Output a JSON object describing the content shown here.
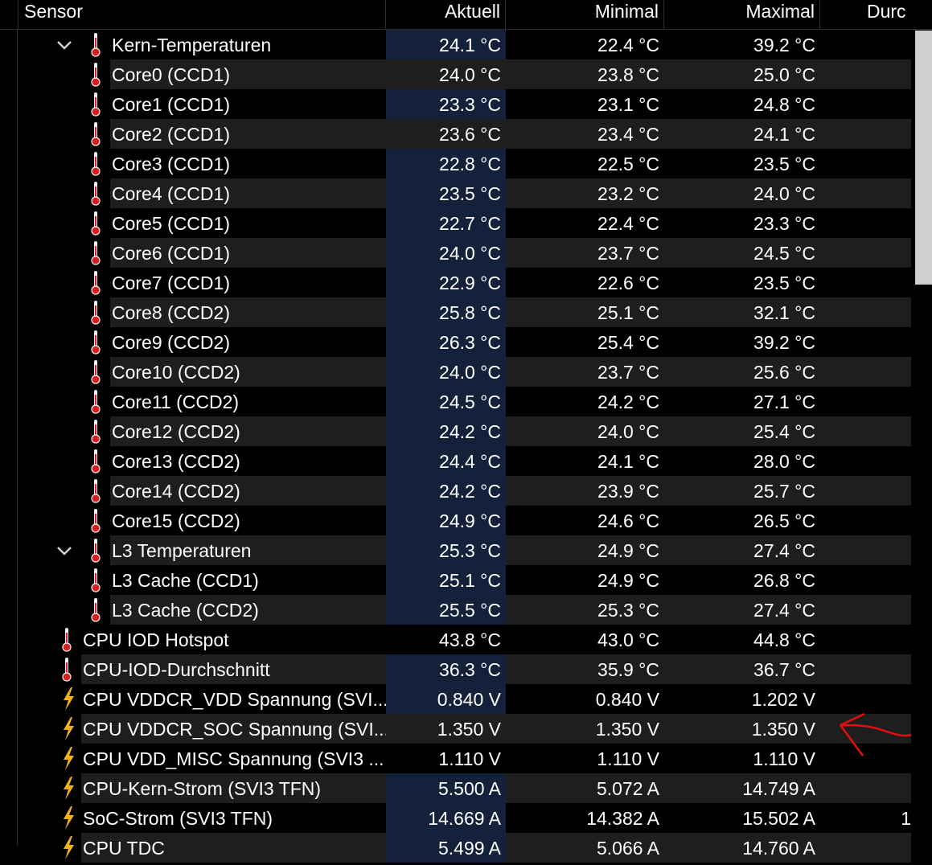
{
  "columns": {
    "sensor": "Sensor",
    "current": "Aktuell",
    "min": "Minimal",
    "max": "Maximal",
    "avg": "Durc"
  },
  "rows": [
    {
      "label": "Kern-Temperaturen",
      "cur": "24.1 °C",
      "min": "22.4 °C",
      "max": "39.2 °C",
      "icon": "thermometer-icon",
      "group": true,
      "level": 1
    },
    {
      "label": "Core0 (CCD1)",
      "cur": "24.0 °C",
      "min": "23.8 °C",
      "max": "25.0 °C",
      "icon": "thermometer-icon",
      "level": 1
    },
    {
      "label": "Core1 (CCD1)",
      "cur": "23.3 °C",
      "min": "23.1 °C",
      "max": "24.8 °C",
      "icon": "thermometer-icon",
      "level": 1
    },
    {
      "label": "Core2 (CCD1)",
      "cur": "23.6 °C",
      "min": "23.4 °C",
      "max": "24.1 °C",
      "icon": "thermometer-icon",
      "level": 1
    },
    {
      "label": "Core3 (CCD1)",
      "cur": "22.8 °C",
      "min": "22.5 °C",
      "max": "23.5 °C",
      "icon": "thermometer-icon",
      "level": 1
    },
    {
      "label": "Core4 (CCD1)",
      "cur": "23.5 °C",
      "min": "23.2 °C",
      "max": "24.0 °C",
      "icon": "thermometer-icon",
      "level": 1
    },
    {
      "label": "Core5 (CCD1)",
      "cur": "22.7 °C",
      "min": "22.4 °C",
      "max": "23.3 °C",
      "icon": "thermometer-icon",
      "level": 1
    },
    {
      "label": "Core6 (CCD1)",
      "cur": "24.0 °C",
      "min": "23.7 °C",
      "max": "24.5 °C",
      "icon": "thermometer-icon",
      "level": 1
    },
    {
      "label": "Core7 (CCD1)",
      "cur": "22.9 °C",
      "min": "22.6 °C",
      "max": "23.5 °C",
      "icon": "thermometer-icon",
      "level": 1
    },
    {
      "label": "Core8 (CCD2)",
      "cur": "25.8 °C",
      "min": "25.1 °C",
      "max": "32.1 °C",
      "icon": "thermometer-icon",
      "level": 1
    },
    {
      "label": "Core9 (CCD2)",
      "cur": "26.3 °C",
      "min": "25.4 °C",
      "max": "39.2 °C",
      "icon": "thermometer-icon",
      "level": 1
    },
    {
      "label": "Core10 (CCD2)",
      "cur": "24.0 °C",
      "min": "23.7 °C",
      "max": "25.6 °C",
      "icon": "thermometer-icon",
      "level": 1
    },
    {
      "label": "Core11 (CCD2)",
      "cur": "24.5 °C",
      "min": "24.2 °C",
      "max": "27.1 °C",
      "icon": "thermometer-icon",
      "level": 1
    },
    {
      "label": "Core12 (CCD2)",
      "cur": "24.2 °C",
      "min": "24.0 °C",
      "max": "25.4 °C",
      "icon": "thermometer-icon",
      "level": 1
    },
    {
      "label": "Core13 (CCD2)",
      "cur": "24.4 °C",
      "min": "24.1 °C",
      "max": "28.0 °C",
      "icon": "thermometer-icon",
      "level": 1
    },
    {
      "label": "Core14 (CCD2)",
      "cur": "24.2 °C",
      "min": "23.9 °C",
      "max": "25.7 °C",
      "icon": "thermometer-icon",
      "level": 1
    },
    {
      "label": "Core15 (CCD2)",
      "cur": "24.9 °C",
      "min": "24.6 °C",
      "max": "26.5 °C",
      "icon": "thermometer-icon",
      "level": 1
    },
    {
      "label": "L3 Temperaturen",
      "cur": "25.3 °C",
      "min": "24.9 °C",
      "max": "27.4 °C",
      "icon": "thermometer-icon",
      "group": true,
      "level": 1
    },
    {
      "label": "L3 Cache (CCD1)",
      "cur": "25.1 °C",
      "min": "24.9 °C",
      "max": "26.8 °C",
      "icon": "thermometer-icon",
      "level": 1
    },
    {
      "label": "L3 Cache (CCD2)",
      "cur": "25.5 °C",
      "min": "25.3 °C",
      "max": "27.4 °C",
      "icon": "thermometer-icon",
      "level": 1
    },
    {
      "label": "CPU IOD Hotspot",
      "cur": "43.8 °C",
      "min": "43.0 °C",
      "max": "44.8 °C",
      "icon": "thermometer-icon",
      "level": 0
    },
    {
      "label": "CPU-IOD-Durchschnitt",
      "cur": "36.3 °C",
      "min": "35.9 °C",
      "max": "36.7 °C",
      "icon": "thermometer-icon",
      "level": 0
    },
    {
      "label": "CPU VDDCR_VDD Spannung (SVI...",
      "cur": "0.840 V",
      "min": "0.840 V",
      "max": "1.202 V",
      "icon": "lightning-icon",
      "level": 0
    },
    {
      "label": "CPU VDDCR_SOC Spannung (SVI...",
      "cur": "1.350 V",
      "min": "1.350 V",
      "max": "1.350 V",
      "icon": "lightning-icon",
      "level": 0
    },
    {
      "label": "CPU VDD_MISC Spannung (SVI3 ...",
      "cur": "1.110 V",
      "min": "1.110 V",
      "max": "1.110 V",
      "icon": "lightning-icon",
      "level": 0
    },
    {
      "label": "CPU-Kern-Strom (SVI3 TFN)",
      "cur": "5.500 A",
      "min": "5.072 A",
      "max": "14.749 A",
      "icon": "lightning-icon",
      "level": 0
    },
    {
      "label": "SoC-Strom (SVI3 TFN)",
      "cur": "14.669 A",
      "min": "14.382 A",
      "max": "15.502 A",
      "avg": "1",
      "icon": "lightning-icon",
      "level": 0
    },
    {
      "label": "CPU TDC",
      "cur": "5.499 A",
      "min": "5.066 A",
      "max": "14.760 A",
      "icon": "lightning-icon",
      "level": 0
    }
  ],
  "selected_current_rows": [
    0,
    2,
    4,
    5,
    6,
    7,
    8,
    9,
    10,
    11,
    12,
    13,
    14,
    15,
    16,
    17,
    18,
    19,
    21,
    22,
    25,
    26,
    27
  ],
  "colors": {
    "annotation_arrow": "#e01010",
    "thermo": "#d81e1e",
    "bolt": "#f2b21c",
    "selection": "#14213a"
  }
}
